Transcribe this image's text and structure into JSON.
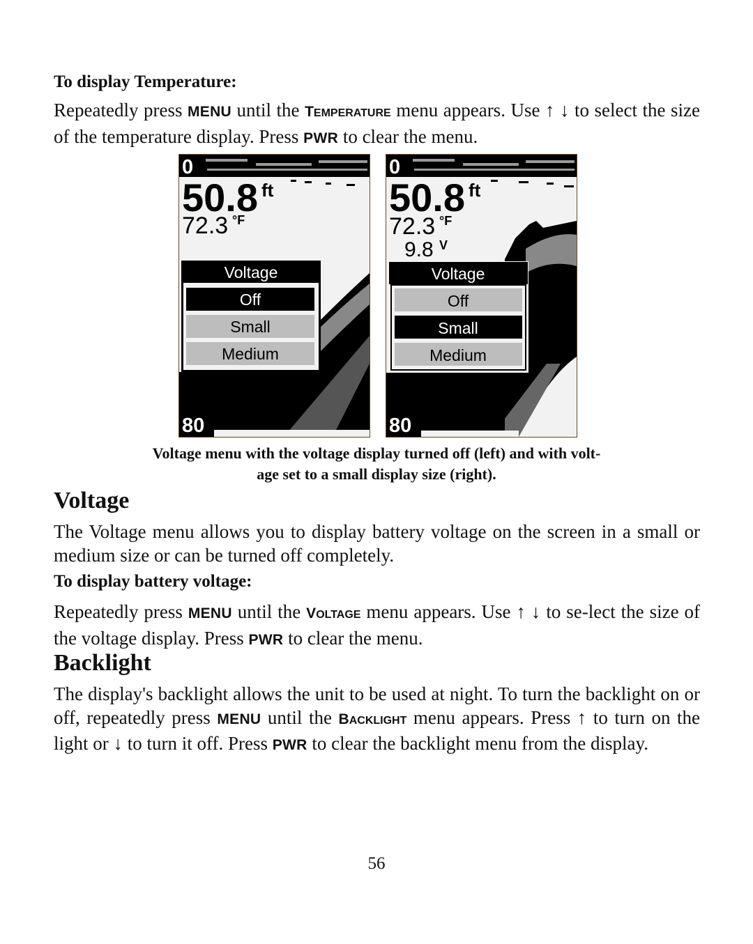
{
  "section_temperature": {
    "heading": "To display Temperature:",
    "text": [
      "Repeatedly press ",
      "MENU",
      " until the ",
      "T",
      "EMPERATURE",
      " menu appears. Use ",
      "↑ ↓",
      " to select the size of the temperature display. Press ",
      "PWR",
      " to clear the menu."
    ]
  },
  "screens": [
    {
      "top_depth_label": "0",
      "depth": "50.8",
      "depth_unit": "ft",
      "temperature": "72.3",
      "temperature_unit": "°F",
      "voltage": "",
      "voltage_unit": "",
      "menu_title": "Voltage",
      "options": [
        "Off",
        "Small",
        "Medium"
      ],
      "selected": "Off",
      "bottom_depth_label": "80"
    },
    {
      "top_depth_label": "0",
      "depth": "50.8",
      "depth_unit": "ft",
      "temperature": "72.3",
      "temperature_unit": "°F",
      "voltage": "9.8",
      "voltage_unit": "V",
      "menu_title": "Voltage",
      "options": [
        "Off",
        "Small",
        "Medium"
      ],
      "selected": "Small",
      "bottom_depth_label": "80"
    }
  ],
  "caption": [
    "Voltage menu with the voltage display turned off (left) and with volt-",
    "age set to a small display size (right)."
  ],
  "section_voltage": {
    "title": "Voltage",
    "intro": "The Voltage menu allows you to display battery voltage on the screen in a small or medium size or can be turned off completely.",
    "heading": "To display battery voltage:",
    "text": [
      "Repeatedly press ",
      "MENU",
      " until the ",
      "V",
      "OLTAGE",
      " menu appears. Use ",
      "↑ ↓",
      " to se-lect the size of the voltage display. Press ",
      "PWR",
      " to clear the menu."
    ]
  },
  "section_backlight": {
    "title": "Backlight",
    "text": [
      "The display's backlight allows the unit to be used at night. To turn the backlight on or off, repeatedly press ",
      "MENU",
      " until the ",
      "B",
      "ACKLIGHT",
      " menu appears. Press ",
      "↑",
      " to turn on the light or ",
      "↓",
      " to turn it off. Press ",
      "PWR",
      " to clear the backlight menu from the display."
    ]
  },
  "page_number": "56",
  "colors": {
    "screen_black": "#000000",
    "screen_light": "#f2f2f2",
    "screen_gray": "#bdbdbd",
    "screen_border": "#6b4a2a"
  }
}
